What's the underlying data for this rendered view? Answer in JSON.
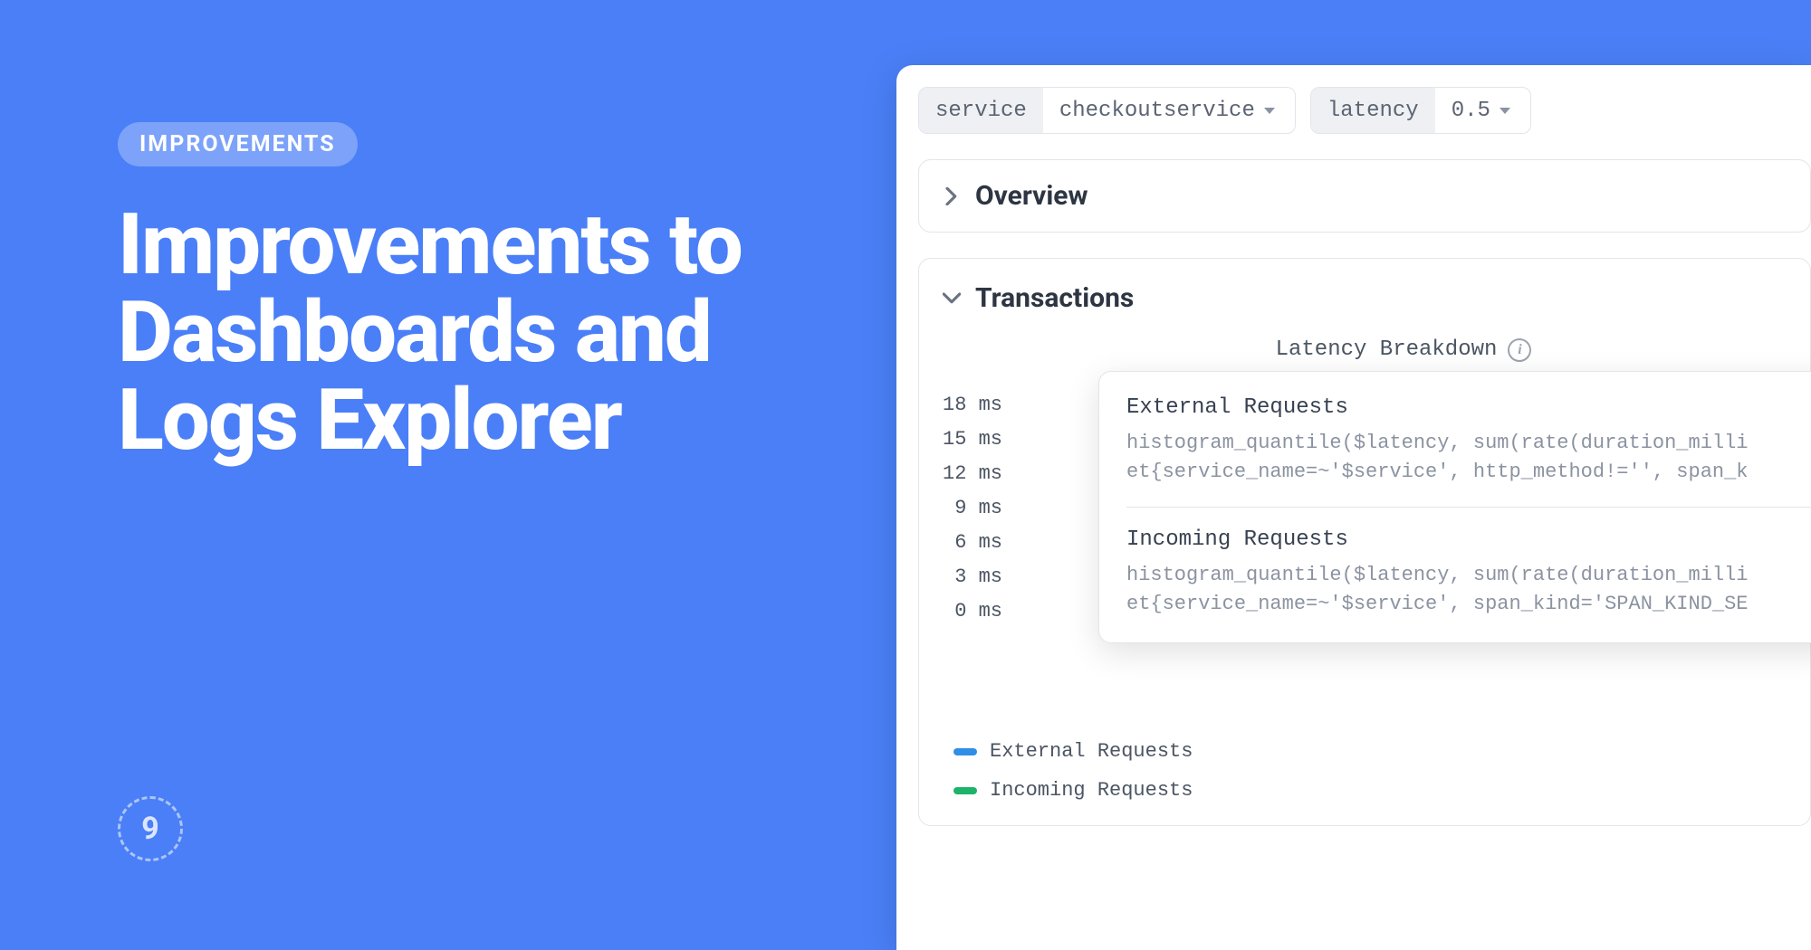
{
  "left": {
    "badge": "IMPROVEMENTS",
    "headline": "Improvements to Dashboards and Logs Explorer",
    "logo_text": "9"
  },
  "filters": {
    "service": {
      "key": "service",
      "value": "checkoutservice"
    },
    "latency": {
      "key": "latency",
      "value": "0.5"
    }
  },
  "sections": {
    "overview_label": "Overview",
    "transactions_label": "Transactions"
  },
  "chart": {
    "title": "Latency Breakdown",
    "y_ticks": [
      "18 ms",
      "15 ms",
      "12 ms",
      "9 ms",
      "6 ms",
      "3 ms",
      "0 ms"
    ]
  },
  "tooltip": {
    "external": {
      "title": "External Requests",
      "code": "histogram_quantile($latency, sum(rate(duration_milli\net{service_name=~'$service', http_method!='', span_k"
    },
    "incoming": {
      "title": "Incoming Requests",
      "code": "histogram_quantile($latency, sum(rate(duration_milli\net{service_name=~'$service', span_kind='SPAN_KIND_SE"
    }
  },
  "legend": {
    "external": "External Requests",
    "incoming": "Incoming Requests"
  },
  "chart_data": {
    "type": "line",
    "title": "Latency Breakdown",
    "ylabel": "ms",
    "ylim": [
      0,
      18
    ],
    "y_ticks": [
      0,
      3,
      6,
      9,
      12,
      15,
      18
    ],
    "series": [
      {
        "name": "External Requests",
        "color": "#2F8FE6"
      },
      {
        "name": "Incoming Requests",
        "color": "#1DB36A"
      }
    ],
    "note": "chart plot area obscured by tooltip; data points not visible in screenshot"
  }
}
